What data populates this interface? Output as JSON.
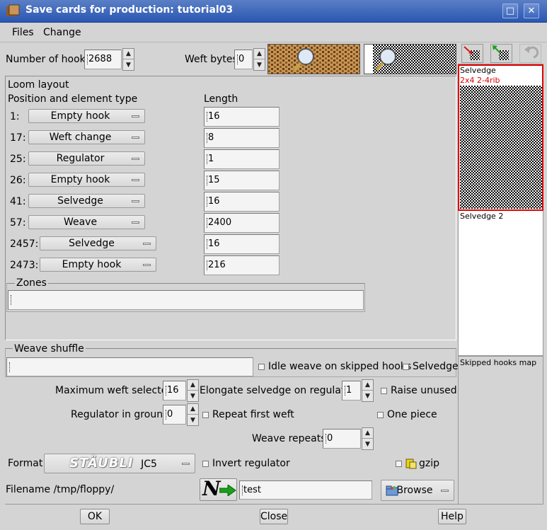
{
  "window": {
    "title": "Save cards for production: tutorial03",
    "buttons": {
      "maximize": "□",
      "close": "✕"
    }
  },
  "menu": {
    "files": "Files",
    "change": "Change"
  },
  "toolbar": {
    "hooks_label": "Number of hooks",
    "hooks_value": "2688",
    "weft_label": "Weft bytes",
    "weft_value": "0"
  },
  "loom": {
    "title": "Loom layout",
    "col_position": "Position and element type",
    "col_length": "Length",
    "rows": [
      {
        "pos": "1:",
        "type": "Empty hook",
        "length": "16"
      },
      {
        "pos": "17:",
        "type": "Weft change",
        "length": "8"
      },
      {
        "pos": "25:",
        "type": "Regulator",
        "length": "1"
      },
      {
        "pos": "26:",
        "type": "Empty hook",
        "length": "15"
      },
      {
        "pos": "41:",
        "type": "Selvedge",
        "length": "16"
      },
      {
        "pos": "57:",
        "type": "Weave",
        "length": "2400"
      },
      {
        "pos": "2457:",
        "type": "Selvedge",
        "length": "16"
      },
      {
        "pos": "2473:",
        "type": "Empty hook",
        "length": "216"
      }
    ],
    "zones_label": "Zones",
    "zones_value": ""
  },
  "side": {
    "selvedge_label": "Selvedge",
    "selvedge_pattern": "2x4 2-4rib",
    "selvedge2_label": "Selvedge 2",
    "skipped_label": "Skipped hooks map"
  },
  "shuffle": {
    "label": "Weave shuffle",
    "value": "",
    "idle_label": "Idle weave on skipped hooks",
    "selvedge_label": "Selvedge"
  },
  "options": {
    "max_weft_label": "Maximum weft selectors",
    "max_weft_value": "16",
    "elongate_label": "Elongate selvedge on regulator",
    "elongate_value": "1",
    "raise_unused_label": "Raise unused",
    "regulator_ground_label": "Regulator in ground",
    "regulator_ground_value": "0",
    "repeat_first_label": "Repeat first weft",
    "one_piece_label": "One piece",
    "weave_repeats_label": "Weave repeats",
    "weave_repeats_value": "0",
    "format_label": "Format",
    "format_brand": "STÄUBLI",
    "format_model": "JC5",
    "invert_label": "Invert regulator",
    "gzip_label": "gzip",
    "filename_label": "Filename /tmp/floppy/",
    "filename_value": "test",
    "browse_label": "Browse",
    "new_icon_letter": "N"
  },
  "footer": {
    "ok": "OK",
    "close": "Close",
    "help": "Help"
  },
  "colors": {
    "titlebar": "#2a57b2",
    "selvedge_border": "#e00000",
    "arrow_green": "#1aa01a",
    "arrow_red": "#d01a1a"
  }
}
